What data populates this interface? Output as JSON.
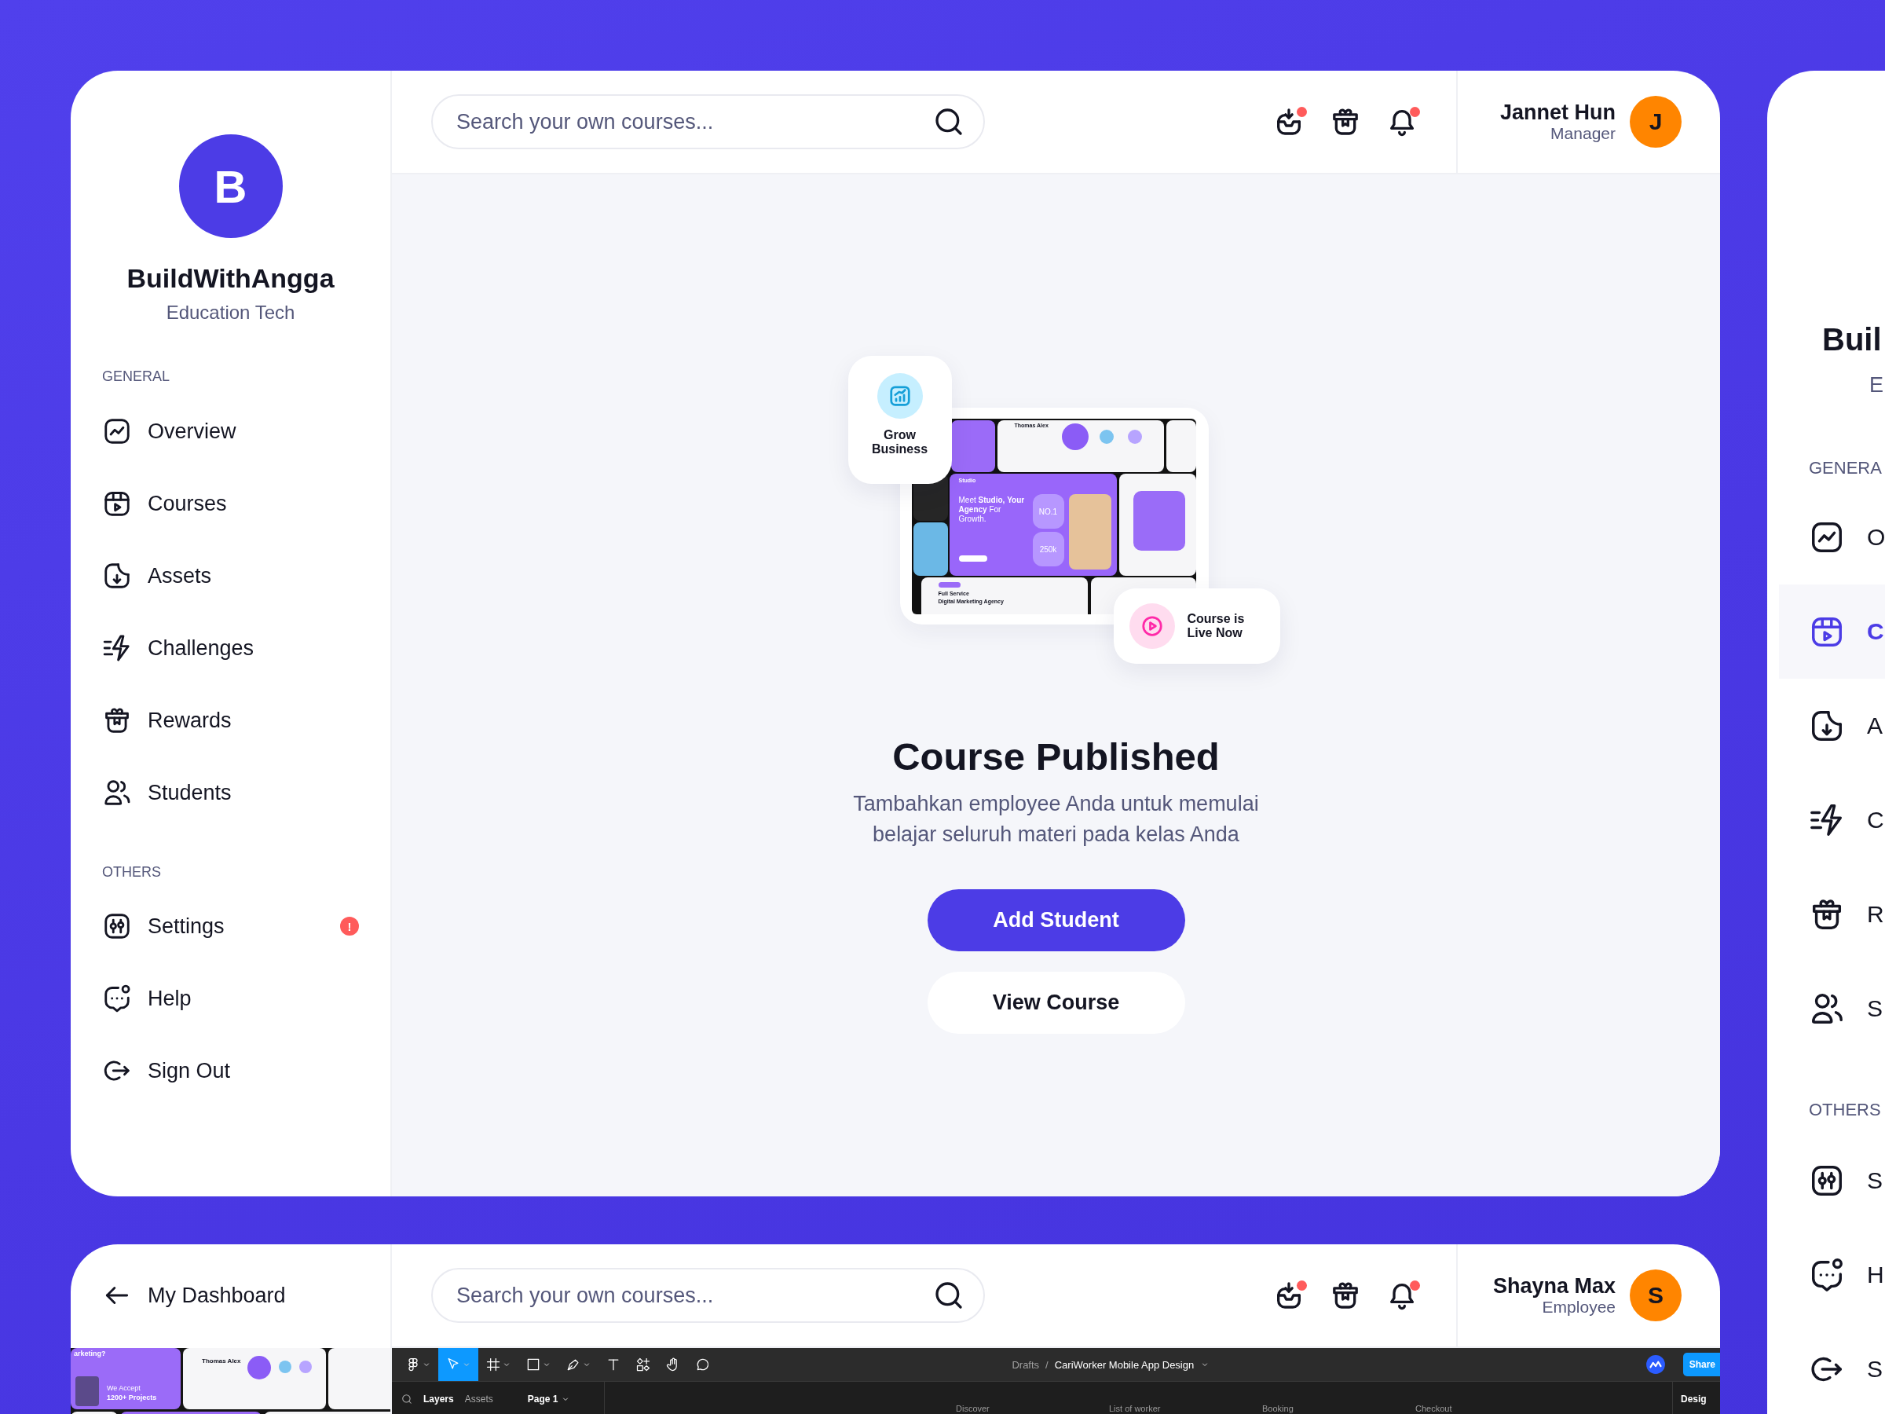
{
  "dashboard": {
    "brand": {
      "initial": "B",
      "name": "BuildWithAngga",
      "subtitle": "Education Tech"
    },
    "sections": [
      {
        "title": "GENERAL",
        "items": [
          {
            "label": "Overview",
            "selected": false
          },
          {
            "label": "Courses",
            "selected": false
          },
          {
            "label": "Assets",
            "selected": false
          },
          {
            "label": "Challenges",
            "selected": false
          },
          {
            "label": "Rewards",
            "selected": false
          },
          {
            "label": "Students",
            "selected": false
          }
        ]
      },
      {
        "title": "OTHERS",
        "items": [
          {
            "label": "Settings",
            "selected": false,
            "badge": "!"
          },
          {
            "label": "Help",
            "selected": false
          },
          {
            "label": "Sign Out",
            "selected": false
          }
        ]
      }
    ],
    "search": {
      "placeholder": "Search your own courses..."
    },
    "header_icons": [
      {
        "dot": true
      },
      {
        "dot": false
      },
      {
        "dot": true
      }
    ],
    "user": {
      "name": "Jannet Hun",
      "role": "Manager",
      "initial": "J"
    },
    "illustration": {
      "grow_label": "Grow Business",
      "live_label": "Course is Live Now",
      "mockup": {
        "brand": "Studio",
        "headline": "Meet **Studio,** **Your Agency** For Growth.",
        "stats": [
          "NO.1",
          "250k"
        ],
        "testimonial_name": "Thomas Alex",
        "service_title": "Full Service",
        "service_subtitle": "Digital Marketing Agency"
      }
    },
    "title": "Course Published",
    "message": "Tambahkan employee Anda untuk memulai belajar seluruh materi pada kelas Anda",
    "buttons": [
      {
        "label": "Add Student",
        "kind": "primary"
      },
      {
        "label": "View Course",
        "kind": "secondary"
      }
    ]
  },
  "second_screen": {
    "back_label": "My Dashboard",
    "search": {
      "placeholder": "Search your own courses..."
    },
    "header_icons": [
      {
        "dot": true
      },
      {
        "dot": false
      },
      {
        "dot": true
      }
    ],
    "user": {
      "name": "Shayna Max",
      "role": "Employee",
      "initial": "S"
    },
    "preview": {
      "headline": "arketing?",
      "accept": "We Accept",
      "projects": "1200+ Projects",
      "testimonial_name": "Thomas Alex"
    },
    "editor": {
      "tools": [
        {
          "selected": false
        },
        {
          "selected": true
        },
        {
          "selected": false
        },
        {
          "selected": false
        },
        {
          "selected": false
        },
        {
          "selected": false
        },
        {
          "selected": false
        },
        {
          "selected": false
        },
        {
          "selected": false
        }
      ],
      "breadcrumb_root": "Drafts",
      "separator": "/",
      "file_name": "CariWorker Mobile App Design",
      "share": "Share",
      "panel_tabs": [
        {
          "label": "Layers",
          "selected": true
        },
        {
          "label": "Assets",
          "selected": false
        }
      ],
      "page": "Page 1",
      "frames": [
        "Discover",
        "List of worker",
        "Booking",
        "Checkout"
      ],
      "right_panel_tab": "Desig"
    }
  },
  "side_screen": {
    "brand_name": "Buil",
    "brand_subtitle": "E",
    "sections": [
      {
        "title": "GENERA",
        "items": [
          {
            "label": "O",
            "selected": false
          },
          {
            "label": "C",
            "selected": true
          },
          {
            "label": "A",
            "selected": false
          },
          {
            "label": "C",
            "selected": false
          },
          {
            "label": "R",
            "selected": false
          },
          {
            "label": "S",
            "selected": false
          }
        ]
      },
      {
        "title": "OTHERS",
        "items": [
          {
            "label": "S",
            "selected": false
          },
          {
            "label": "H",
            "selected": false
          },
          {
            "label": "S",
            "selected": false
          }
        ]
      }
    ]
  }
}
